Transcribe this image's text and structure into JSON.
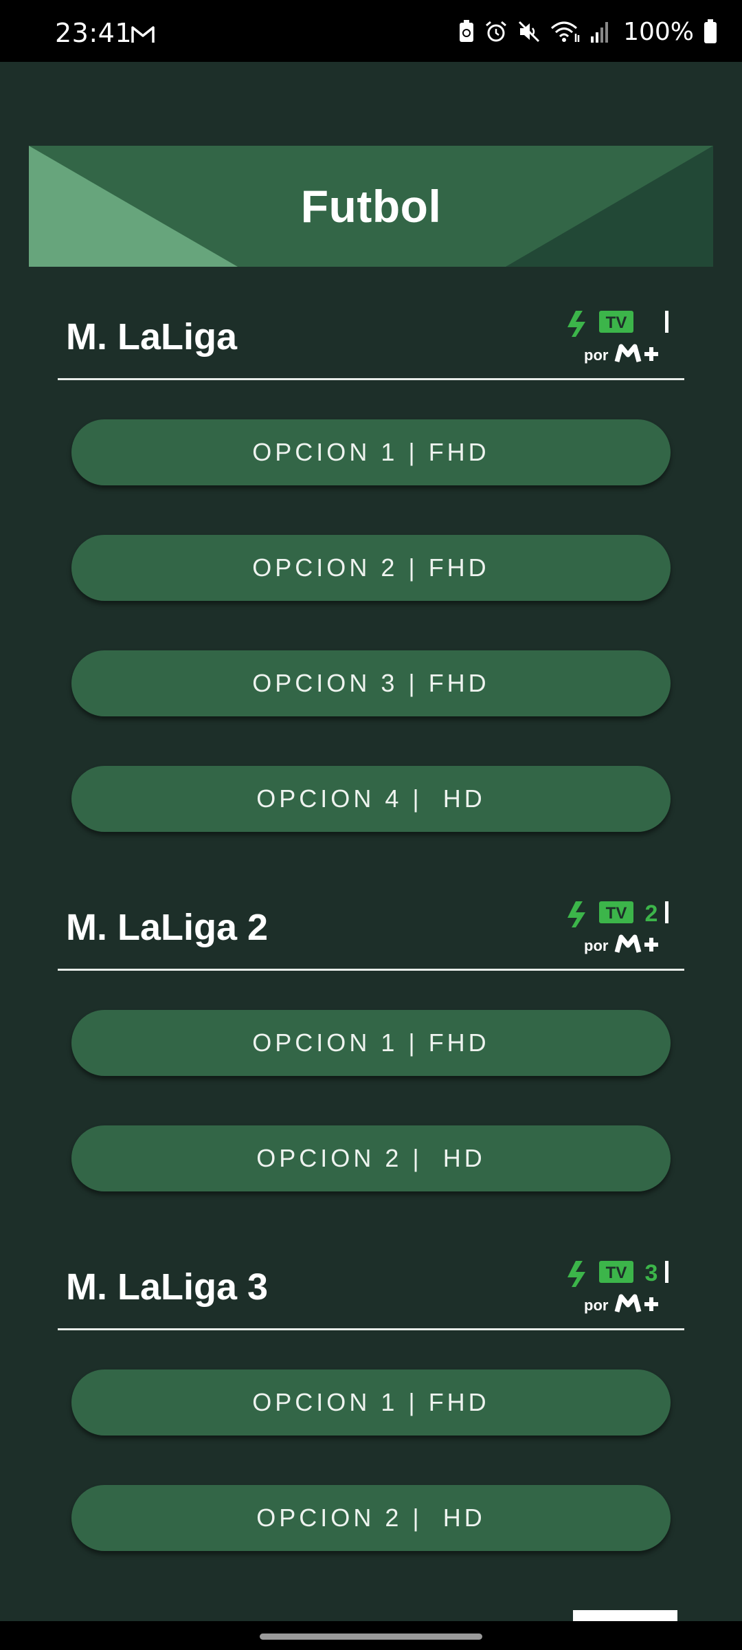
{
  "status_bar": {
    "time": "23:41",
    "notification_icons": [
      "gmail-icon"
    ],
    "system_icons": [
      "battery-saver-icon",
      "alarm-icon",
      "mute-icon",
      "wifi-icon",
      "signal-icon"
    ],
    "battery_percent": "100%"
  },
  "page": {
    "title": "Futbol"
  },
  "sections": [
    {
      "title": "M. LaLiga",
      "logo": {
        "tv": "TV",
        "number": "",
        "por": "por"
      },
      "options": [
        "OPCION 1 | FHD",
        "OPCION 2 | FHD",
        "OPCION 3 | FHD",
        "OPCION 4 |  HD"
      ]
    },
    {
      "title": "M. LaLiga 2",
      "logo": {
        "tv": "TV",
        "number": "2",
        "por": "por"
      },
      "options": [
        "OPCION 1 | FHD",
        "OPCION 2 |  HD"
      ]
    },
    {
      "title": "M. LaLiga 3",
      "logo": {
        "tv": "TV",
        "number": "3",
        "por": "por"
      },
      "options": [
        "OPCION 1 | FHD",
        "OPCION 2 |  HD"
      ]
    }
  ],
  "colors": {
    "background": "#1d2f29",
    "button": "#336647",
    "banner": "#336647",
    "logo_green": "#3cb54a"
  }
}
